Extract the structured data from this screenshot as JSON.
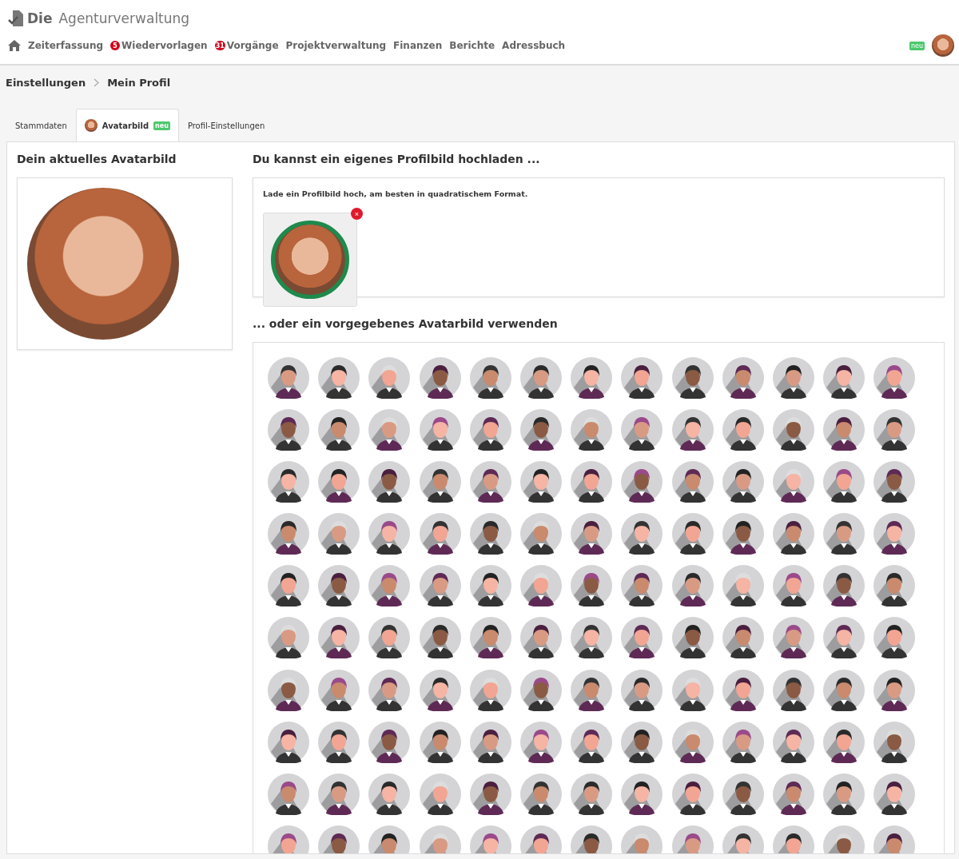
{
  "app": {
    "logo_text": "Die",
    "title": "Agenturverwaltung"
  },
  "nav": {
    "items": [
      {
        "label": "Zeiterfassung"
      },
      {
        "label": "Wiedervorlagen",
        "badge": "5"
      },
      {
        "label": "Vorgänge",
        "badge": "31"
      },
      {
        "label": "Projektverwaltung"
      },
      {
        "label": "Finanzen"
      },
      {
        "label": "Berichte"
      },
      {
        "label": "Adressbuch"
      }
    ],
    "user_badge": "neu"
  },
  "breadcrumb": [
    "Einstellungen",
    "Mein Profil"
  ],
  "tabs": [
    {
      "label": "Stammdaten",
      "selected": false
    },
    {
      "label": "Avatarbild",
      "selected": true,
      "badge": "neu",
      "icon": true
    },
    {
      "label": "Profil-Einstellungen",
      "selected": false
    }
  ],
  "current_avatar": {
    "heading": "Dein aktuelles Avatarbild"
  },
  "upload": {
    "heading": "Du kannst ein eigenes Profilbild hochladen ...",
    "hint": "Lade ein Profilbild hoch, am besten in quadratischem Format.",
    "remove_symbol": "×"
  },
  "presets": {
    "heading": "... oder ein vorgegebenes Avatarbild verwenden"
  }
}
